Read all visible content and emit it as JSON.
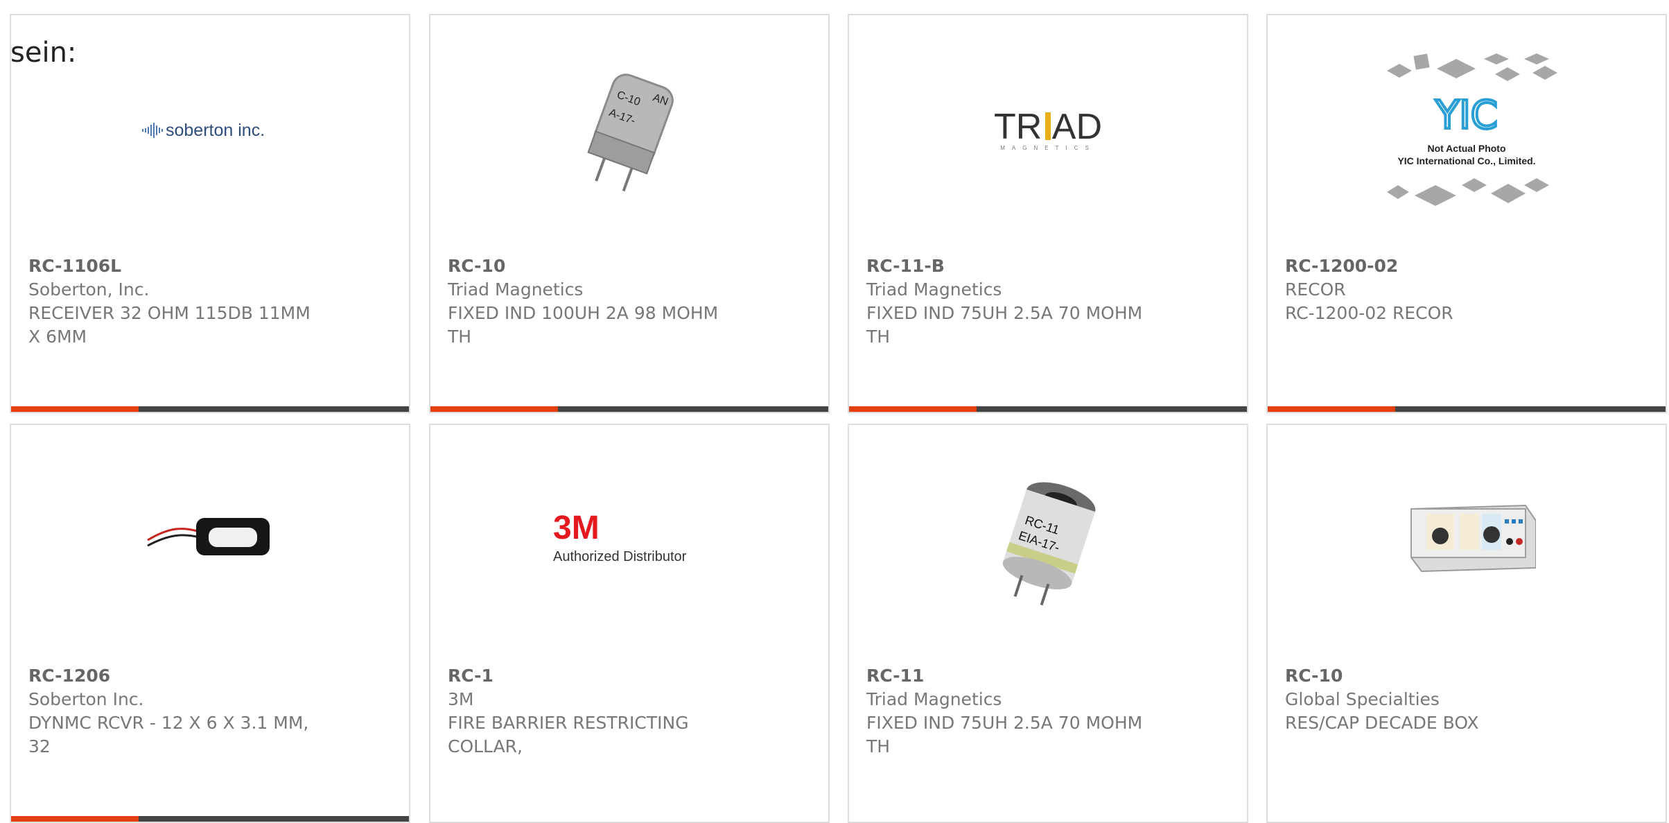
{
  "page": {
    "label": "sein:"
  },
  "products": [
    {
      "part": "RC-1106L",
      "maker": "Soberton, Inc.",
      "desc_line1": "RECEIVER 32 OHM 115DB 11MM",
      "desc_line2": "X 6MM",
      "image": "soberton-logo",
      "logo_text": "soberton inc."
    },
    {
      "part": "RC-10",
      "maker": "Triad Magnetics",
      "desc_line1": "FIXED IND 100UH 2A 98 MOHM",
      "desc_line2": "TH",
      "image": "inductor-photo",
      "photo_text1": "C-10",
      "photo_text2": "A-17-",
      "photo_text3": "AN"
    },
    {
      "part": "RC-11-B",
      "maker": "Triad Magnetics",
      "desc_line1": "FIXED IND 75UH 2.5A 70 MOHM",
      "desc_line2": "TH",
      "image": "triad-logo",
      "logo_text": "TRIAD",
      "logo_sub": "MAGNETICS"
    },
    {
      "part": "RC-1200-02",
      "maker": "RECOR",
      "desc_line1": "RC-1200-02 RECOR",
      "desc_line2": "",
      "image": "yic-placeholder",
      "logo_text": "YIC",
      "caption1": "Not Actual Photo",
      "caption2": "YIC International Co., Limited."
    },
    {
      "part": "RC-1206",
      "maker": "Soberton Inc.",
      "desc_line1": "DYNMC RCVR - 12 X 6 X 3.1 MM,",
      "desc_line2": "32",
      "image": "receiver-photo"
    },
    {
      "part": "RC-1",
      "maker": "3M",
      "desc_line1": "FIRE BARRIER RESTRICTING",
      "desc_line2": "COLLAR,",
      "image": "3m-logo",
      "logo_text": "3M",
      "logo_sub": "Authorized Distributor"
    },
    {
      "part": "RC-11",
      "maker": "Triad Magnetics",
      "desc_line1": "FIXED IND 75UH 2.5A 70 MOHM",
      "desc_line2": "TH",
      "image": "inductor-photo-2",
      "photo_text1": "RC-11",
      "photo_text2": "EIA-17-"
    },
    {
      "part": "RC-10",
      "maker": "Global Specialties",
      "desc_line1": "RES/CAP DECADE BOX",
      "desc_line2": "",
      "image": "decade-box-photo"
    }
  ],
  "colors": {
    "accent": "#e4400f",
    "bar": "#444444",
    "border": "#dedede",
    "text": "#666666"
  }
}
